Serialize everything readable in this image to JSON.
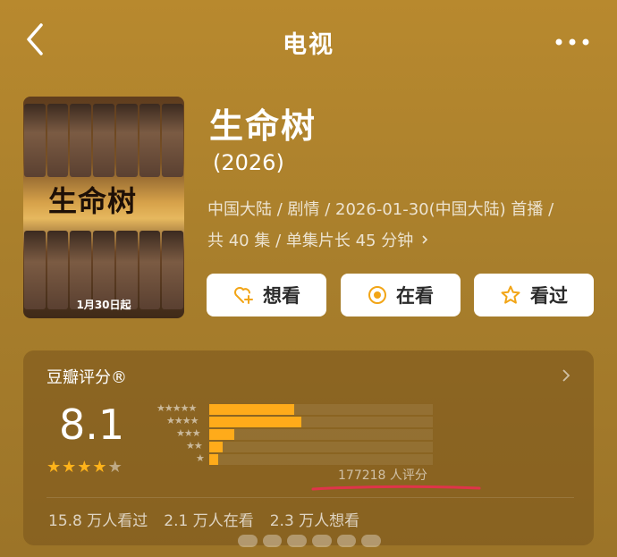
{
  "header": {
    "title": "电视",
    "back_icon": "chevron-left-icon",
    "more_icon": "more-dots-icon"
  },
  "poster": {
    "title_art": "生命树",
    "date_text": "1月30日起"
  },
  "show": {
    "title": "生命树",
    "year": "(2026)",
    "meta_line1": "中国大陆 / 剧情 / 2026-01-30(中国大陆) 首播 /",
    "meta_line2": "共 40 集 / 单集片长 45 分钟"
  },
  "actions": {
    "want": {
      "label": "想看",
      "icon": "heart-plus-icon"
    },
    "watching": {
      "label": "在看",
      "icon": "target-circle-icon"
    },
    "watched": {
      "label": "看过",
      "icon": "star-outline-icon"
    }
  },
  "rating": {
    "header": "豆瓣评分®",
    "score": "8.1",
    "stars_filled": 4,
    "stars_total": 5,
    "distribution": [
      {
        "stars": "★★★★★",
        "fraction": 0.38
      },
      {
        "stars": "★★★★",
        "fraction": 0.41
      },
      {
        "stars": "★★★",
        "fraction": 0.11
      },
      {
        "stars": "★★",
        "fraction": 0.06
      },
      {
        "stars": "★",
        "fraction": 0.04
      }
    ],
    "count_text": "177218 人评分",
    "stats": {
      "watched": "15.8 万人看过",
      "watching": "2.1 万人在看",
      "want": "2.3 万人想看"
    }
  },
  "colors": {
    "background": "#b8892e",
    "accent_star": "#ffb31a",
    "bar": "#ffab1a",
    "underline": "#e0344a"
  }
}
